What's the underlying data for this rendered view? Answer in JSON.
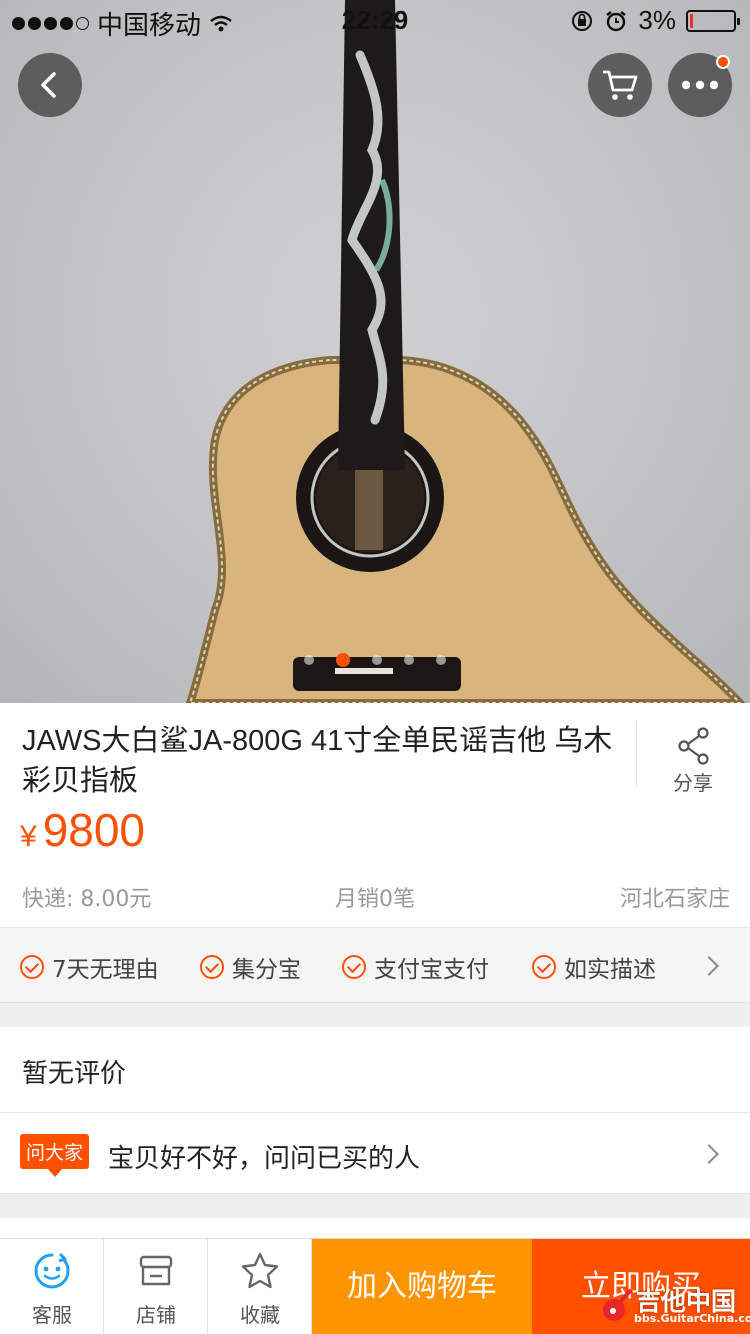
{
  "status_bar": {
    "carrier": "中国移动",
    "time": "22:29",
    "battery": "3%"
  },
  "product": {
    "title": "JAWS大白鲨JA-800G 41寸全单民谣吉他 乌木彩贝指板",
    "share_label": "分享",
    "currency": "¥",
    "price": "9800",
    "shipping": "快递: 8.00元",
    "monthly_sales": "月销0笔",
    "location": "河北石家庄"
  },
  "guarantees": [
    "7天无理由",
    "集分宝",
    "支付宝支付",
    "如实描述"
  ],
  "reviews": {
    "label": "暂无评价"
  },
  "ask": {
    "tag": "问大家",
    "text": "宝贝好不好，问问已买的人"
  },
  "bottom_bar": {
    "service": "客服",
    "shop": "店铺",
    "favorite": "收藏",
    "add_to_cart": "加入购物车",
    "buy_now": "立即购买"
  },
  "watermark": {
    "text": "吉他中国",
    "url": "bbs.GuitarChina.com"
  },
  "colors": {
    "accent": "#ff5000",
    "cart_button": "#ff9402"
  }
}
